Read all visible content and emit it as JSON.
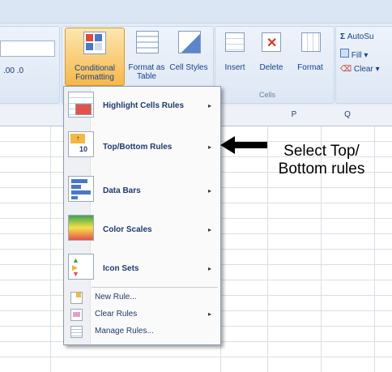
{
  "ribbon": {
    "conditional_formatting": "Conditional Formatting",
    "format_as_table": "Format as Table",
    "cell_styles": "Cell Styles",
    "insert": "Insert",
    "delete": "Delete",
    "format": "Format",
    "cells_group": "Cells",
    "autosum": "AutoSu",
    "fill": "Fill",
    "clear": "Clear"
  },
  "columns": {
    "p": "P",
    "q": "Q"
  },
  "menu": {
    "items": [
      {
        "label": "Highlight Cells Rules",
        "arrow": "▸"
      },
      {
        "label": "Top/Bottom Rules",
        "arrow": "▸"
      },
      {
        "label": "Data Bars",
        "arrow": "▸"
      },
      {
        "label": "Color Scales",
        "arrow": "▸"
      },
      {
        "label": "Icon Sets",
        "arrow": "▸"
      }
    ],
    "footer": [
      {
        "label": "New Rule..."
      },
      {
        "label": "Clear Rules",
        "arrow": "▸"
      },
      {
        "label": "Manage Rules..."
      }
    ]
  },
  "annotation": {
    "line1": "Select Top/",
    "line2": "Bottom rules"
  },
  "colors": {
    "ribbon_bg": "#e4ecf7",
    "highlight": "#fbd48a",
    "menu_text": "#1f3a6e"
  }
}
